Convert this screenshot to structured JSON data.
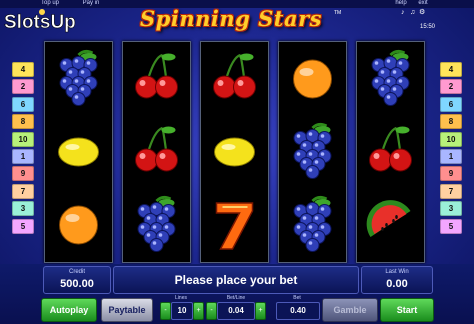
{
  "topbar": {
    "top_up": "Top up",
    "pay_in": "Pay in",
    "help": "help",
    "exit": "exit",
    "time": "15:50"
  },
  "brand": {
    "name": "SlotsUp"
  },
  "game": {
    "title": "Spinning Stars",
    "trademark": "TM"
  },
  "lines": {
    "left": [
      {
        "n": "4",
        "color": "#ffd84a"
      },
      {
        "n": "2",
        "color": "#ffd84a"
      },
      {
        "n": "6",
        "color": "#ffd84a"
      },
      {
        "n": "8",
        "color": "#ffd84a"
      },
      {
        "n": "10",
        "color": "#ffd84a"
      },
      {
        "n": "1",
        "color": "#ffd84a"
      },
      {
        "n": "9",
        "color": "#ffd84a"
      },
      {
        "n": "7",
        "color": "#ffd84a"
      },
      {
        "n": "3",
        "color": "#ffd84a"
      },
      {
        "n": "5",
        "color": "#ffd84a"
      }
    ],
    "right": [
      {
        "n": "4",
        "color": "#ffd84a"
      },
      {
        "n": "2",
        "color": "#ffd84a"
      },
      {
        "n": "6",
        "color": "#ffd84a"
      },
      {
        "n": "8",
        "color": "#ffd84a"
      },
      {
        "n": "10",
        "color": "#ffd84a"
      },
      {
        "n": "1",
        "color": "#ffd84a"
      },
      {
        "n": "9",
        "color": "#ffd84a"
      },
      {
        "n": "7",
        "color": "#ffd84a"
      },
      {
        "n": "3",
        "color": "#ffd84a"
      },
      {
        "n": "5",
        "color": "#ffd84a"
      }
    ],
    "palette": [
      "#ffe45a",
      "#ff9ad0",
      "#7fd7ff",
      "#ffc04d",
      "#b7f07a",
      "#a9b6ff",
      "#ff8f8f",
      "#ffd0a0",
      "#9af0d8",
      "#f3a6ff"
    ]
  },
  "reels": [
    [
      "grapes-icon",
      "lemon-icon",
      "orange-icon"
    ],
    [
      "cherries-icon",
      "cherries-icon",
      "grapes-icon"
    ],
    [
      "cherries-icon",
      "lemon-icon",
      "seven-icon"
    ],
    [
      "orange-icon",
      "grapes-icon",
      "grapes-icon"
    ],
    [
      "grapes-icon",
      "cherries-icon",
      "watermelon-icon"
    ]
  ],
  "panel": {
    "credit_label": "Credit",
    "credit_value": "500.00",
    "message": "Please place your bet",
    "last_win_label": "Last Win",
    "last_win_value": "0.00"
  },
  "controls": {
    "autoplay": "Autoplay",
    "paytable": "Paytable",
    "lines_label": "Lines",
    "lines_value": "10",
    "bet_line_label": "Bet/Line",
    "bet_line_value": "0.04",
    "bet_label": "Bet",
    "bet_value": "0.40",
    "gamble": "Gamble",
    "start": "Start",
    "minus": "-",
    "plus": "+"
  }
}
